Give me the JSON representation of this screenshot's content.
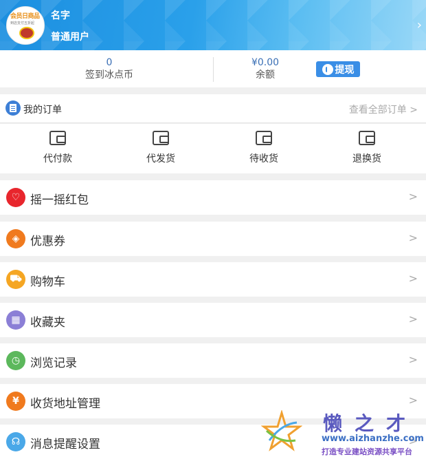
{
  "header": {
    "avatar_logo_top": "会员日商品",
    "avatar_logo_sub": "到店支付五折起",
    "username": "名字",
    "user_level": "普通用户",
    "chevron": "›"
  },
  "balance": {
    "points_value": "0",
    "points_label": "签到冰点币",
    "money_value": "¥0.00",
    "money_label": "余额",
    "withdraw_label": "提现"
  },
  "orders": {
    "title": "我的订单",
    "view_all": "查看全部订单 >",
    "items": [
      {
        "label": "代付款",
        "icon": "wallet-icon"
      },
      {
        "label": "代发货",
        "icon": "wallet-icon"
      },
      {
        "label": "待收货",
        "icon": "wallet-icon"
      },
      {
        "label": "退换货",
        "icon": "wallet-icon"
      }
    ]
  },
  "menu": [
    {
      "label": "摇一摇红包",
      "icon": "heart-icon",
      "color": "#e8262d",
      "glyph": "♡"
    },
    {
      "label": "优惠券",
      "icon": "tag-icon",
      "color": "#f07a1e",
      "glyph": "◈"
    },
    {
      "label": "购物车",
      "icon": "cart-icon",
      "color": "#f5a623",
      "glyph": "⛟"
    },
    {
      "label": "收藏夹",
      "icon": "grid-icon",
      "color": "#8b7fd6",
      "glyph": "▦"
    },
    {
      "label": "浏览记录",
      "icon": "clock-icon",
      "color": "#5cb85c",
      "glyph": "◷"
    },
    {
      "label": "收货地址管理",
      "icon": "yen-icon",
      "color": "#f07a1e",
      "glyph": "¥"
    },
    {
      "label": "消息提醒设置",
      "icon": "headset-icon",
      "color": "#4aa8e8",
      "glyph": "☊"
    }
  ],
  "menu_chevron": ">",
  "watermark": {
    "brand": "懒之才",
    "url": "www.aizhanzhe.com",
    "slogan": "打造专业建站资源共享平台"
  }
}
